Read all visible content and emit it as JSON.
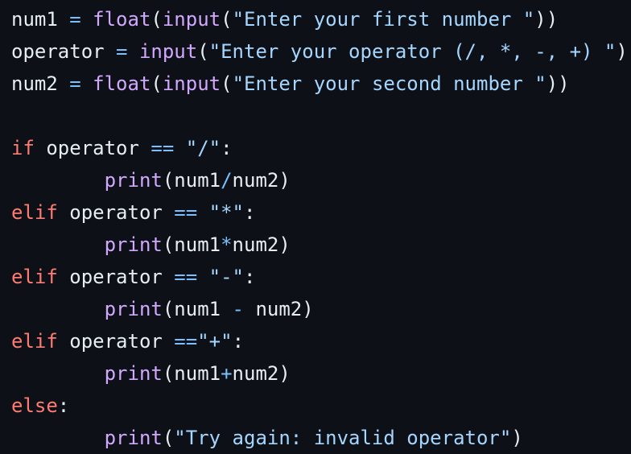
{
  "code_lines": [
    [
      {
        "t": "num1 ",
        "k": "plain"
      },
      {
        "t": "=",
        "k": "op"
      },
      {
        "t": " ",
        "k": "plain"
      },
      {
        "t": "float",
        "k": "builtin"
      },
      {
        "t": "(",
        "k": "plain"
      },
      {
        "t": "input",
        "k": "builtin"
      },
      {
        "t": "(",
        "k": "plain"
      },
      {
        "t": "\"Enter your first number \"",
        "k": "string"
      },
      {
        "t": "))",
        "k": "plain"
      }
    ],
    [
      {
        "t": "operator ",
        "k": "plain"
      },
      {
        "t": "=",
        "k": "op"
      },
      {
        "t": " ",
        "k": "plain"
      },
      {
        "t": "input",
        "k": "builtin"
      },
      {
        "t": "(",
        "k": "plain"
      },
      {
        "t": "\"Enter your operator (/, *, -, +) \"",
        "k": "string"
      },
      {
        "t": ")",
        "k": "plain"
      }
    ],
    [
      {
        "t": "num2 ",
        "k": "plain"
      },
      {
        "t": "=",
        "k": "op"
      },
      {
        "t": " ",
        "k": "plain"
      },
      {
        "t": "float",
        "k": "builtin"
      },
      {
        "t": "(",
        "k": "plain"
      },
      {
        "t": "input",
        "k": "builtin"
      },
      {
        "t": "(",
        "k": "plain"
      },
      {
        "t": "\"Enter your second number \"",
        "k": "string"
      },
      {
        "t": "))",
        "k": "plain"
      }
    ],
    [],
    [
      {
        "t": "if",
        "k": "keyword"
      },
      {
        "t": " operator ",
        "k": "plain"
      },
      {
        "t": "==",
        "k": "op"
      },
      {
        "t": " ",
        "k": "plain"
      },
      {
        "t": "\"/\"",
        "k": "string"
      },
      {
        "t": ":",
        "k": "plain"
      }
    ],
    [
      {
        "t": "        ",
        "k": "plain"
      },
      {
        "t": "print",
        "k": "builtin"
      },
      {
        "t": "(num1",
        "k": "plain"
      },
      {
        "t": "/",
        "k": "op"
      },
      {
        "t": "num2)",
        "k": "plain"
      }
    ],
    [
      {
        "t": "elif",
        "k": "keyword"
      },
      {
        "t": " operator ",
        "k": "plain"
      },
      {
        "t": "==",
        "k": "op"
      },
      {
        "t": " ",
        "k": "plain"
      },
      {
        "t": "\"*\"",
        "k": "string"
      },
      {
        "t": ":",
        "k": "plain"
      }
    ],
    [
      {
        "t": "        ",
        "k": "plain"
      },
      {
        "t": "print",
        "k": "builtin"
      },
      {
        "t": "(num1",
        "k": "plain"
      },
      {
        "t": "*",
        "k": "op"
      },
      {
        "t": "num2)",
        "k": "plain"
      }
    ],
    [
      {
        "t": "elif",
        "k": "keyword"
      },
      {
        "t": " operator ",
        "k": "plain"
      },
      {
        "t": "==",
        "k": "op"
      },
      {
        "t": " ",
        "k": "plain"
      },
      {
        "t": "\"-\"",
        "k": "string"
      },
      {
        "t": ":",
        "k": "plain"
      }
    ],
    [
      {
        "t": "        ",
        "k": "plain"
      },
      {
        "t": "print",
        "k": "builtin"
      },
      {
        "t": "(num1 ",
        "k": "plain"
      },
      {
        "t": "-",
        "k": "op"
      },
      {
        "t": " num2)",
        "k": "plain"
      }
    ],
    [
      {
        "t": "elif",
        "k": "keyword"
      },
      {
        "t": " operator ",
        "k": "plain"
      },
      {
        "t": "==",
        "k": "op"
      },
      {
        "t": "\"+\"",
        "k": "string"
      },
      {
        "t": ":",
        "k": "plain"
      }
    ],
    [
      {
        "t": "        ",
        "k": "plain"
      },
      {
        "t": "print",
        "k": "builtin"
      },
      {
        "t": "(num1",
        "k": "plain"
      },
      {
        "t": "+",
        "k": "op"
      },
      {
        "t": "num2)",
        "k": "plain"
      }
    ],
    [
      {
        "t": "else",
        "k": "keyword"
      },
      {
        "t": ":",
        "k": "plain"
      }
    ],
    [
      {
        "t": "        ",
        "k": "plain"
      },
      {
        "t": "print",
        "k": "builtin"
      },
      {
        "t": "(",
        "k": "plain"
      },
      {
        "t": "\"Try again: invalid operator\"",
        "k": "string"
      },
      {
        "t": ")",
        "k": "plain"
      }
    ]
  ],
  "colors": {
    "background": "#0d1117",
    "plain": "#e6edf3",
    "operator": "#79c0ff",
    "builtin": "#d2a8ff",
    "string": "#a5d6ff",
    "keyword": "#ff7b72"
  }
}
